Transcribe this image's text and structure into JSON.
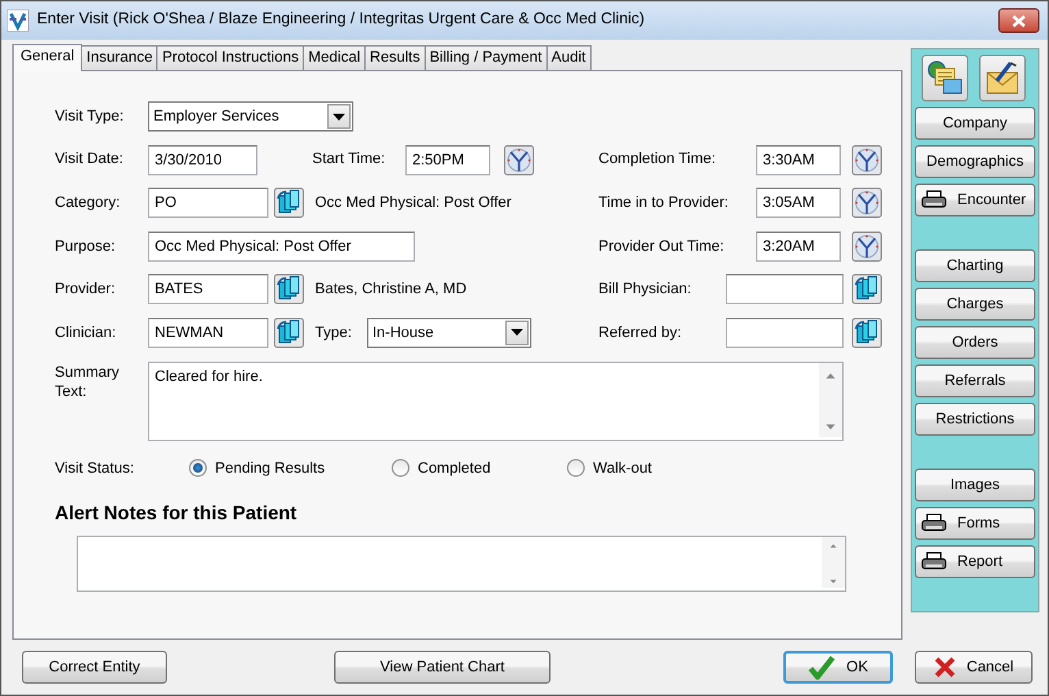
{
  "window": {
    "title": "Enter Visit (Rick O'Shea / Blaze Engineering / Integritas Urgent Care & Occ Med Clinic)"
  },
  "tabs": [
    {
      "label": "General",
      "selected": true
    },
    {
      "label": "Insurance",
      "selected": false
    },
    {
      "label": "Protocol Instructions",
      "selected": false
    },
    {
      "label": "Medical",
      "selected": false
    },
    {
      "label": "Results",
      "selected": false
    },
    {
      "label": "Billing / Payment",
      "selected": false
    },
    {
      "label": "Audit",
      "selected": false
    }
  ],
  "visit_type": {
    "label": "Visit Type:",
    "value": "Employer Services"
  },
  "visit_date": {
    "label": "Visit Date:",
    "value": "3/30/2010"
  },
  "start_time": {
    "label": "Start Time:",
    "value": "2:50PM"
  },
  "completion_time": {
    "label": "Completion Time:",
    "value": "3:30AM"
  },
  "category": {
    "label": "Category:",
    "value": "PO",
    "description": "Occ Med Physical: Post Offer"
  },
  "time_in_to_provider": {
    "label": "Time in to Provider:",
    "value": "3:05AM"
  },
  "purpose": {
    "label": "Purpose:",
    "value": "Occ Med Physical: Post Offer"
  },
  "provider_out_time": {
    "label": "Provider Out Time:",
    "value": "3:20AM"
  },
  "provider": {
    "label": "Provider:",
    "value": "BATES",
    "description": "Bates, Christine A, MD"
  },
  "bill_physician": {
    "label": "Bill Physician:"
  },
  "clinician": {
    "label": "Clinician:",
    "value": "NEWMAN"
  },
  "type": {
    "label": "Type:",
    "value": "In-House"
  },
  "referred_by": {
    "label": "Referred by:"
  },
  "summary": {
    "label": "Summary Text:",
    "value": "Cleared for hire."
  },
  "visit_status": {
    "label": "Visit Status:",
    "options": [
      {
        "label": "Pending Results",
        "selected": true
      },
      {
        "label": "Completed",
        "selected": false
      },
      {
        "label": "Walk-out",
        "selected": false
      }
    ]
  },
  "alert_notes": {
    "title": "Alert Notes for this Patient"
  },
  "sidebar": {
    "groups": [
      [
        {
          "label": "Company",
          "kind": "plain"
        },
        {
          "label": "Demographics",
          "kind": "plain"
        },
        {
          "label": "Encounter",
          "kind": "print"
        }
      ],
      [
        {
          "label": "Charting",
          "kind": "plain"
        },
        {
          "label": "Charges",
          "kind": "plain"
        },
        {
          "label": "Orders",
          "kind": "plain"
        },
        {
          "label": "Referrals",
          "kind": "plain"
        },
        {
          "label": "Restrictions",
          "kind": "plain"
        }
      ],
      [
        {
          "label": "Images",
          "kind": "plain"
        },
        {
          "label": "Forms",
          "kind": "print"
        },
        {
          "label": "Report",
          "kind": "print"
        }
      ]
    ]
  },
  "footer": {
    "buttons": [
      {
        "label": "Correct Entity",
        "kind": "plain"
      },
      {
        "label": "View Patient Chart",
        "kind": "plain"
      },
      {
        "label": "OK",
        "kind": "ok"
      },
      {
        "label": "Cancel",
        "kind": "cancel"
      }
    ]
  }
}
